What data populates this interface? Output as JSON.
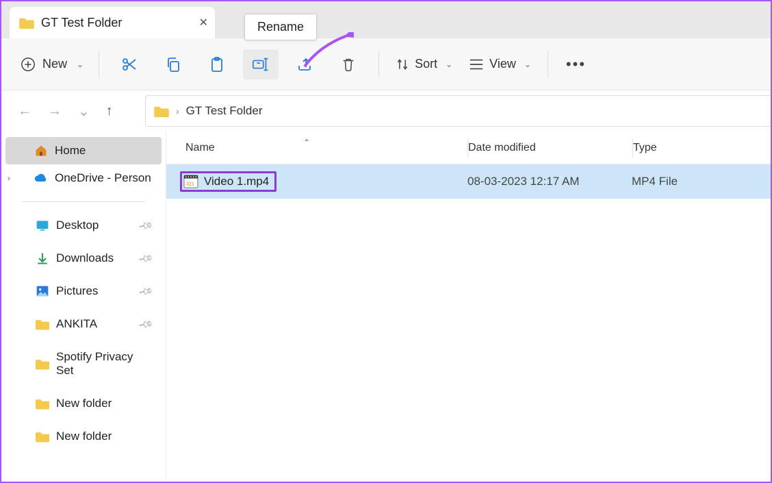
{
  "tab": {
    "title": "GT Test Folder"
  },
  "tooltip": {
    "rename": "Rename"
  },
  "toolbar": {
    "new_label": "New",
    "sort_label": "Sort",
    "view_label": "View"
  },
  "address": {
    "crumb": "GT Test Folder"
  },
  "sidebar": {
    "home": "Home",
    "onedrive": "OneDrive - Person",
    "items": [
      {
        "label": "Desktop",
        "pinned": true,
        "icon": "desktop"
      },
      {
        "label": "Downloads",
        "pinned": true,
        "icon": "downloads"
      },
      {
        "label": "Pictures",
        "pinned": true,
        "icon": "pictures"
      },
      {
        "label": "ANKITA",
        "pinned": true,
        "icon": "folder"
      },
      {
        "label": "Spotify Privacy Set",
        "pinned": false,
        "icon": "folder"
      },
      {
        "label": "New folder",
        "pinned": false,
        "icon": "folder"
      },
      {
        "label": "New folder",
        "pinned": false,
        "icon": "folder"
      }
    ]
  },
  "columns": {
    "name": "Name",
    "date": "Date modified",
    "type": "Type"
  },
  "files": [
    {
      "name": "Video 1.mp4",
      "date": "08-03-2023 12:17 AM",
      "type": "MP4 File"
    }
  ]
}
